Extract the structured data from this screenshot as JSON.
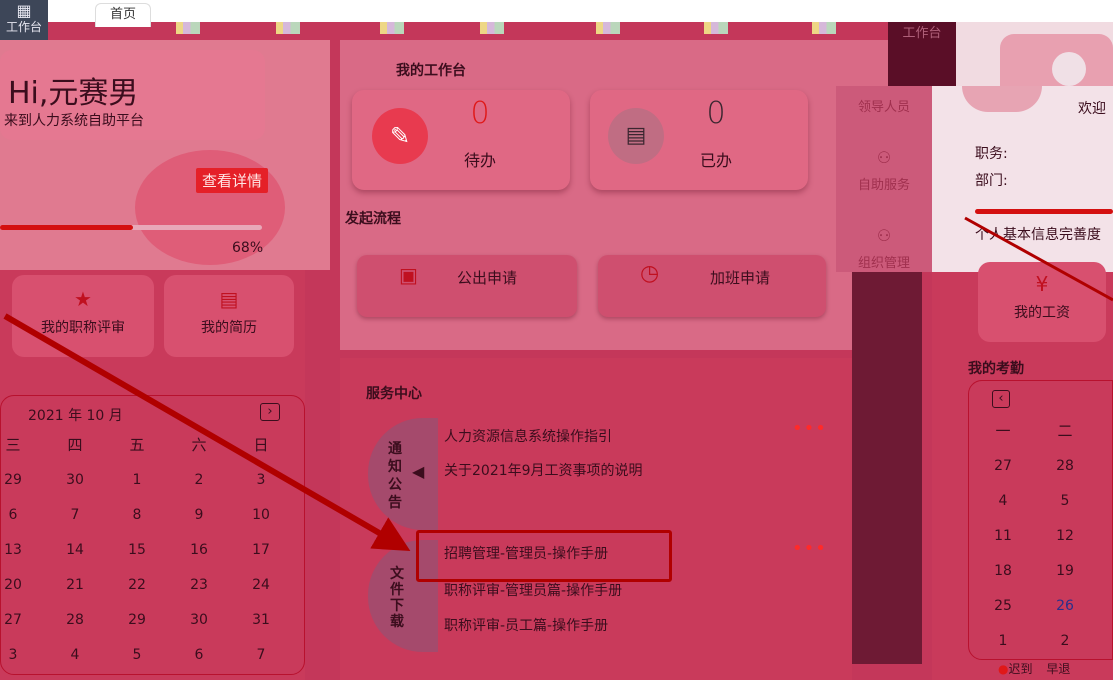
{
  "topbar": {
    "workbench_label": "工作台",
    "home_tab": "首页"
  },
  "profile": {
    "greeting": "Hi,元赛男",
    "welcome_fragment": "来到人力系统自助平台",
    "detail_button": "查看详情",
    "progress_percent": "68%"
  },
  "workbench": {
    "title": "我的工作台",
    "todo_count": "0",
    "todo_label": "待办",
    "done_count": "0",
    "done_label": "已办"
  },
  "processes": {
    "title": "发起流程",
    "items": [
      {
        "label": "公出申请"
      },
      {
        "label": "加班申请"
      }
    ]
  },
  "quick_links": [
    {
      "label": "我的职称评审"
    },
    {
      "label": "我的简历"
    },
    {
      "label": "我的工资"
    }
  ],
  "calendar": {
    "month_label": "2021 年 10 月",
    "next_icon": "›",
    "weekdays": [
      "三",
      "四",
      "五",
      "六",
      "日"
    ],
    "rows": [
      [
        "29",
        "30",
        "1",
        "2",
        "3"
      ],
      [
        "6",
        "7",
        "8",
        "9",
        "10"
      ],
      [
        "13",
        "14",
        "15",
        "16",
        "17"
      ],
      [
        "20",
        "21",
        "22",
        "23",
        "24"
      ],
      [
        "27",
        "28",
        "29",
        "30",
        "31"
      ],
      [
        "3",
        "4",
        "5",
        "6",
        "7"
      ]
    ]
  },
  "service_center": {
    "title": "服务中心",
    "notice_label": "通知公告",
    "notice_items": [
      "人力资源信息系统操作指引",
      "关于2021年9月工资事项的说明"
    ],
    "download_label": "文件下载",
    "download_items": [
      "招聘管理-管理员-操作手册",
      "职称评审-管理员篇-操作手册",
      "职称评审-员工篇-操作手册"
    ],
    "more_dots": "•••"
  },
  "side_nav": {
    "top_label": "工作台",
    "items": [
      "领导人员",
      "自助服务",
      "组织管理"
    ]
  },
  "right_profile": {
    "welcome": "欢迎",
    "position_label": "职务:",
    "dept_label": "部门:",
    "completeness_label": "个人基本信息完善度"
  },
  "attendance": {
    "title": "我的考勤",
    "weekdays": [
      "一",
      "二"
    ],
    "rows": [
      [
        "27",
        "28"
      ],
      [
        "4",
        "5"
      ],
      [
        "11",
        "12"
      ],
      [
        "18",
        "19"
      ],
      [
        "25",
        "26"
      ],
      [
        "1",
        "2"
      ]
    ],
    "legend_fragment": "迟到",
    "legend_fragment2": "早退"
  },
  "colors": {
    "accent": "#e01818",
    "background": "#c4375a",
    "dark_sidebar": "#6e1a34"
  }
}
